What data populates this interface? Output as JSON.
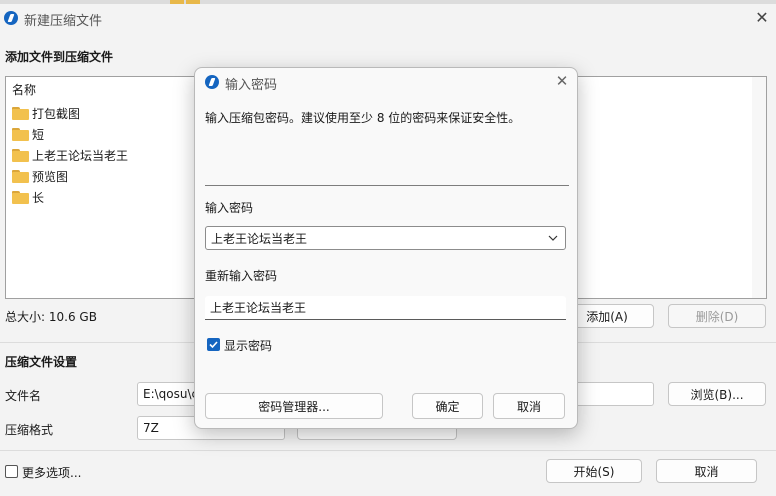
{
  "main": {
    "title": "新建压缩文件",
    "close_glyph": "✕",
    "add_section": "添加文件到压缩文件",
    "list_header": "名称",
    "files": [
      {
        "name": "打包截图"
      },
      {
        "name": "短"
      },
      {
        "name": "上老王论坛当老王"
      },
      {
        "name": "预览图"
      },
      {
        "name": "长"
      }
    ],
    "total_size": "总大小: 10.6 GB",
    "add_button": "添加(A)",
    "delete_button": "删除(D)",
    "settings_section": "压缩文件设置",
    "filename_label": "文件名",
    "filename_value": "E:\\qosu\\c",
    "browse_button": "浏览(B)...",
    "format_label": "压缩格式",
    "format_value": "7Z",
    "more_options": "更多选项...",
    "start_button": "开始(S)",
    "cancel_button": "取消"
  },
  "dialog": {
    "title": "输入密码",
    "close_glyph": "✕",
    "description": "输入压缩包密码。建议使用至少 8 位的密码来保证安全性。",
    "password_label": "输入密码",
    "password_value": "上老王论坛当老王",
    "confirm_label": "重新输入密码",
    "confirm_value": "上老王论坛当老王",
    "show_password_label": "显示密码",
    "show_password_checked": true,
    "manager_button": "密码管理器...",
    "ok_button": "确定",
    "cancel_button": "取消"
  },
  "colors": {
    "accent": "#1565c0",
    "folder": "#f2c14e",
    "link": "#1a5fb4"
  },
  "icons": {
    "app": "bandizip-app-icon",
    "folder": "folder-icon",
    "close": "close-icon",
    "dropdown": "chevron-down-icon",
    "check": "checkmark-icon"
  }
}
